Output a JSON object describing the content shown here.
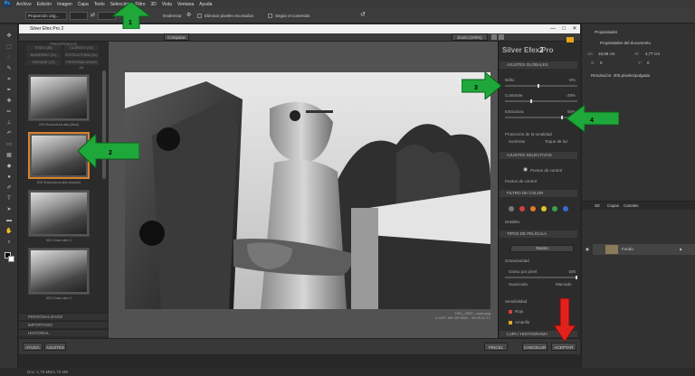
{
  "ps": {
    "logo": "Ps",
    "menu": [
      "Archivo",
      "Edición",
      "Imagen",
      "Capa",
      "Texto",
      "Selección",
      "Filtro",
      "3D",
      "Vista",
      "Ventana",
      "Ayuda"
    ],
    "options": {
      "preset": "Proporción orig...",
      "swap_icon": "⇄",
      "enderezar": "Enderezar",
      "eliminar": "Eliminar píxeles recortados",
      "segun": "Según el contenido"
    },
    "status": "Doc: 1,75 MB/1,75 MB"
  },
  "se": {
    "title": "Silver Efex Pro 2",
    "compare": "Comparar",
    "zoom": "Zoom (100%)",
    "left_categories": [
      "TODO (38)",
      "CLÁSICO (15)",
      "MODERNO (11)",
      "ESTRUCTURA (12)",
      "VINTAGE (12)",
      "PERSONALIZADO (0)"
    ],
    "presets_header": "PREDEFINIDOS",
    "thumb_labels": [
      "000 Estructura alta (fina)",
      "000 Estructura alta (suave)",
      "002 Claro alto 1",
      "003 Claro alto 2"
    ],
    "panels": [
      "PERSONALIZADO",
      "IMPORTADO",
      "HISTORIAL"
    ],
    "buttons": {
      "help": "AYUDA",
      "settings": "AJUSTES",
      "cancel": "CANCELAR",
      "ok": "ACEPTAR",
      "brush": "PINCEL"
    },
    "photo_caption": [
      "DSC_2600 - copia.jpg",
      "4 CAP. 165 DE 5000 - 09.09.21 17"
    ],
    "brand": "Silver Efex Pro",
    "brand_version": "2",
    "global_adjust": "AJUSTES GLOBALES",
    "brillo": "Brillo",
    "brillo_val": "-8%",
    "contraste": "Contraste",
    "contraste_val": "-29%",
    "estructura": "Estructura",
    "estructura_val": "55%",
    "tonality": "Protección de la tonalidad",
    "sombras": "Sombras",
    "toque_luz": "Toque de luz",
    "selective": "AJUSTES SELECTIVOS",
    "control_point": "Puntos de control",
    "control_point_btn": "Puntos de control",
    "color_filter": "FILTRO DE COLOR",
    "detalles": "Detalles",
    "film_type": "TIPOS DE PELÍCULA",
    "film_value": "Neutro",
    "grain": "Granulosidad",
    "grain_per_pixel": "Grano por píxel",
    "grain_val": "500",
    "suavizado": "Suavizado",
    "marcado": "Marcado",
    "sensitivity": "Sensibilidad",
    "rojo": "Rojo",
    "amarillo": "Amarillo",
    "loupe": "LUPA / HISTOGRAMA"
  },
  "ps_right": {
    "props_tab": "Propiedades",
    "props_title": "Propiedades del documento",
    "an_label": "An:",
    "an_val": "16,56 cm",
    "al_label": "Al:",
    "al_val": "4,77 cm",
    "x_label": "X:",
    "x_val": "0",
    "y_label": "Y:",
    "y_val": "0",
    "res": "Resolución: 300 píxeles/pulgada",
    "tabs": [
      "3D",
      "Capas",
      "Canales"
    ],
    "layer_name": "Fondo"
  },
  "annotations": [
    "1",
    "2",
    "3",
    "4"
  ],
  "colors": {
    "arrow_green": "#1fa83a",
    "arrow_red": "#e0221c",
    "accent_orange": "#d9822b"
  }
}
